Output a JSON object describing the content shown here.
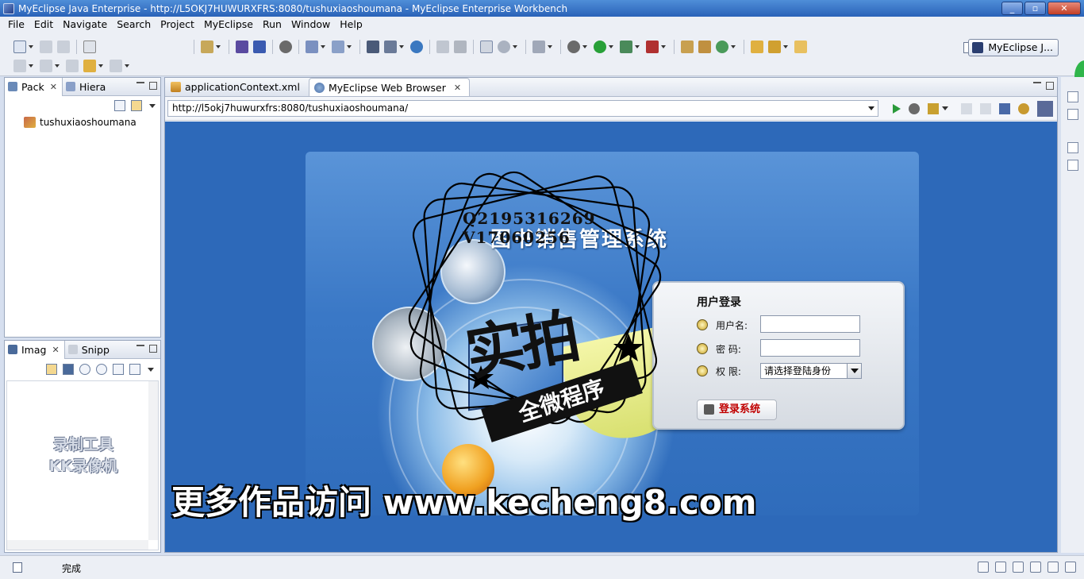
{
  "window": {
    "title": "MyEclipse Java Enterprise - http://L5OKJ7HUWURXFRS:8080/tushuxiaoshoumana - MyEclipse Enterprise Workbench"
  },
  "menu": [
    "File",
    "Edit",
    "Navigate",
    "Search",
    "Project",
    "MyEclipse",
    "Run",
    "Window",
    "Help"
  ],
  "toolbar": {
    "perspective_label": "MyEclipse J..."
  },
  "package_view": {
    "tabs": [
      "Pack",
      "Hiera"
    ],
    "tree": [
      "tushuxiaoshoumana"
    ]
  },
  "image_view": {
    "tabs": [
      "Imag",
      "Snipp"
    ],
    "recorder_watermark": [
      "录制工具",
      "KK录像机"
    ]
  },
  "editor": {
    "tabs": [
      "applicationContext.xml",
      "MyEclipse Web Browser"
    ],
    "url": "http://l5okj7huwurxfrs:8080/tushuxiaoshoumana/"
  },
  "webpage": {
    "system_title": "图书销售管理系统",
    "login": {
      "heading": "用户登录",
      "username_label": "用户名:",
      "password_label": "密  码:",
      "role_label": "权  限:",
      "role_selected": "请选择登陆身份",
      "submit_label": "登录系统"
    }
  },
  "watermarks": {
    "qq_line1": "Q2195316269",
    "qq_line2": "V17060256",
    "stamp_big": "实拍",
    "stamp_ribbon": "全微程序",
    "site": "更多作品访问 www.kecheng8.com"
  },
  "statusbar": {
    "text": "完成"
  },
  "colors": {
    "page_background": "#2d69b9",
    "login_submit_text": "#c00000",
    "title_bar": "#2a62b8"
  }
}
